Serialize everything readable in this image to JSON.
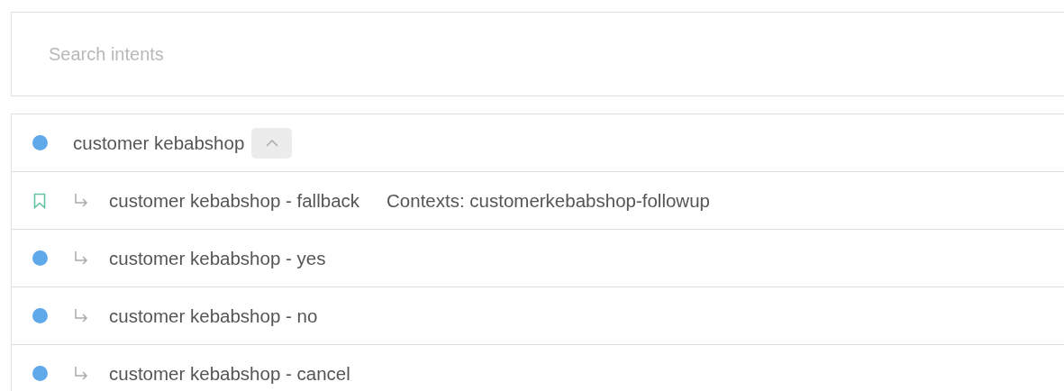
{
  "search": {
    "placeholder": "Search intents"
  },
  "intents": [
    {
      "name": "customer kebabshop",
      "kind": "dot",
      "expanded": true,
      "children": [
        {
          "name": "customer kebabshop - fallback",
          "kind": "fallback",
          "contexts": "Contexts: customerkebabshop-followup"
        },
        {
          "name": "customer kebabshop - yes",
          "kind": "dot"
        },
        {
          "name": "customer kebabshop - no",
          "kind": "dot"
        },
        {
          "name": "customer kebabshop - cancel",
          "kind": "dot"
        }
      ]
    }
  ]
}
